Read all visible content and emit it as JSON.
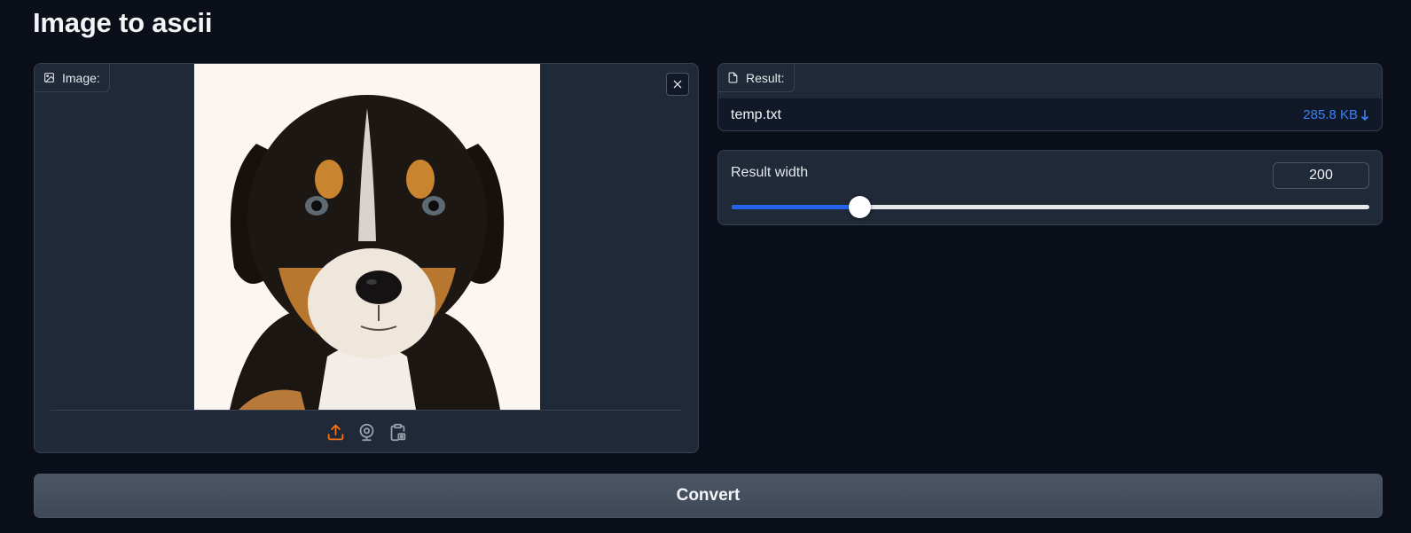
{
  "page": {
    "title": "Image to ascii"
  },
  "image_input": {
    "label": "Image:",
    "label_icon": "image-icon",
    "clear_icon": "close-icon",
    "image_subject": "puppy",
    "sources": [
      {
        "name": "upload-source-button",
        "icon": "upload-icon",
        "color": "#f97316"
      },
      {
        "name": "webcam-source-button",
        "icon": "webcam-icon",
        "color": "#9ca3af"
      },
      {
        "name": "clipboard-source-button",
        "icon": "clipboard-icon",
        "color": "#9ca3af"
      }
    ]
  },
  "result": {
    "label": "Result:",
    "label_icon": "file-icon",
    "file_name": "temp.txt",
    "file_size": "285.8 KB",
    "download_icon": "download-arrow-icon"
  },
  "width_slider": {
    "label": "Result width",
    "value": "200",
    "fraction": 0.2
  },
  "actions": {
    "convert_label": "Convert"
  },
  "colors": {
    "background": "#0b0f19",
    "panel": "#1f2937",
    "accent_blue": "#2563eb",
    "link_blue": "#3b82f6",
    "upload_orange": "#f97316",
    "button": "#4b5563"
  }
}
